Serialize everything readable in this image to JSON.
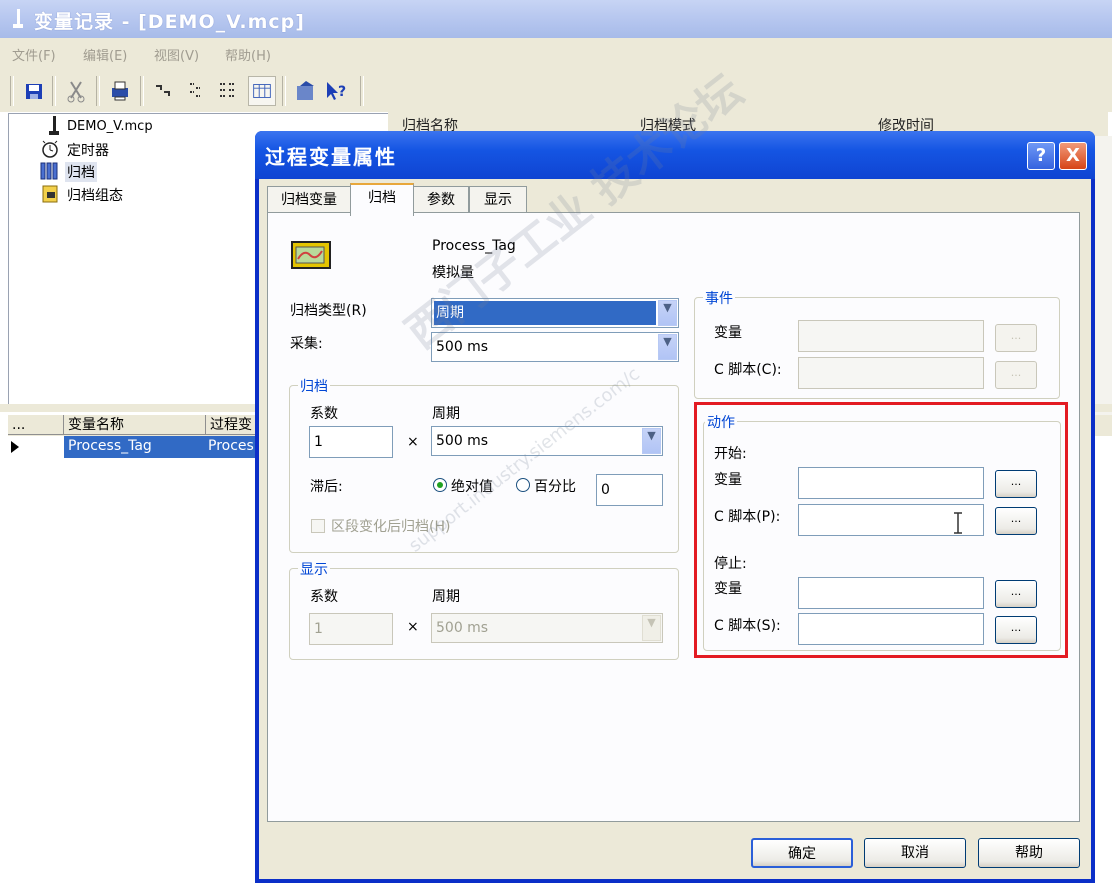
{
  "window": {
    "title": "变量记录 - [DEMO_V.mcp]",
    "menu": [
      "文件(F)",
      "编辑(E)",
      "视图(V)",
      "帮助(H)"
    ]
  },
  "toolbar": {
    "icons": [
      "save-icon",
      "cut-icon",
      "print-icon",
      "tag-icon",
      "timer-icon",
      "archive-icon",
      "table-icon",
      "properties-icon",
      "help-pointer-icon"
    ]
  },
  "tree": {
    "root": "DEMO_V.mcp",
    "items": [
      "定时器",
      "归档",
      "归档组态"
    ]
  },
  "right_table": {
    "columns": [
      "归档名称",
      "归档模式",
      "修改时间"
    ]
  },
  "tag_grid": {
    "columns": [
      "...",
      "变量名称",
      "过程变"
    ],
    "row": {
      "name": "Process_Tag",
      "process": "Proces"
    }
  },
  "dialog": {
    "title": "过程变量属性",
    "help": "?",
    "close": "X",
    "tabs": [
      "归档变量",
      "归档",
      "参数",
      "显示"
    ],
    "active_tab": "归档",
    "tag_name": "Process_Tag",
    "tag_type": "模拟量",
    "archive_type_label": "归档类型(R)",
    "archive_type_value": "周期",
    "acquire_label": "采集:",
    "acquire_value": "500 ms",
    "archive_group": {
      "title": "归档",
      "factor_label": "系数",
      "period_label": "周期",
      "factor_value": "1",
      "times": "×",
      "period_value": "500 ms",
      "lag_label": "滞后:",
      "absolute_label": "绝对值",
      "percent_label": "百分比",
      "lag_value": "0",
      "segment_label": "区段变化后归档(H)"
    },
    "display_group": {
      "title": "显示",
      "factor_label": "系数",
      "period_label": "周期",
      "factor_value": "1",
      "times": "×",
      "period_value": "500 ms"
    },
    "event_group": {
      "title": "事件",
      "tag_label": "变量",
      "script_label": "C 脚本(C):",
      "ellipsis": "..."
    },
    "action_group": {
      "title": "动作",
      "start_label": "开始:",
      "start_tag_label": "变量",
      "start_script_label": "C 脚本(P):",
      "stop_label": "停止:",
      "stop_tag_label": "变量",
      "stop_script_label": "C 脚本(S):",
      "ellipsis": "..."
    },
    "buttons": {
      "ok": "确定",
      "cancel": "取消",
      "help": "帮助"
    }
  },
  "highlight_color": "#e31b23",
  "watermark": "西门子工业 技术论坛",
  "watermark_url": "support.industry.siemens.com/c"
}
